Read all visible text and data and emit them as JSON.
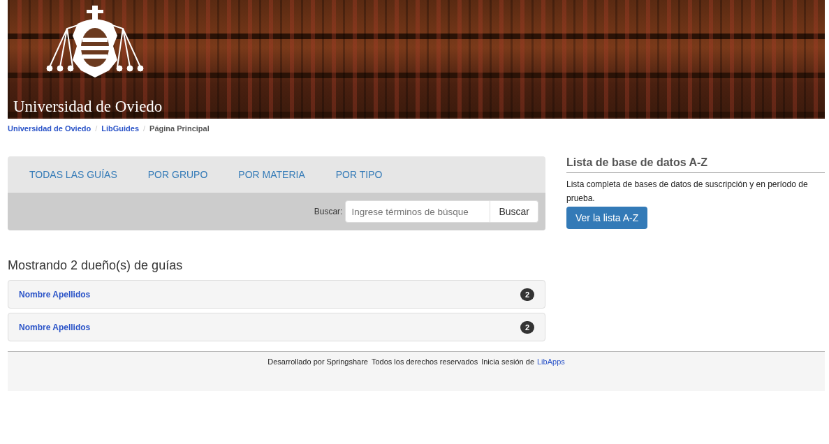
{
  "banner": {
    "logo_text": "Universidad de Oviedo"
  },
  "breadcrumb_separator": "/",
  "breadcrumb": [
    {
      "label": "Universidad de Oviedo",
      "kind": "link"
    },
    {
      "label": "LibGuides",
      "kind": "link"
    },
    {
      "label": "Página Principal",
      "kind": "current"
    }
  ],
  "nav_tabs": [
    "TODAS LAS GUÍAS",
    "POR GRUPO",
    "POR MATERIA",
    "POR TIPO"
  ],
  "search": {
    "label": "Buscar:",
    "placeholder": "Ingrese términos de búsque",
    "button": "Buscar"
  },
  "owners": {
    "heading": "Mostrando 2 dueño(s) de guías",
    "items": [
      {
        "name": "Nombre Apellidos",
        "count": "2"
      },
      {
        "name": "Nombre Apellidos",
        "count": "2"
      }
    ]
  },
  "sidebar": {
    "title": "Lista de base de datos A-Z",
    "text": "Lista completa de bases de datos de suscripción y en período de prueba.",
    "button": "Ver la lista A-Z"
  },
  "footer": {
    "powered": "Desarrollado por Springshare",
    "rights": "Todos los derechos reservados",
    "login_text": "Inicia sesión de",
    "login_link": "LibApps"
  }
}
